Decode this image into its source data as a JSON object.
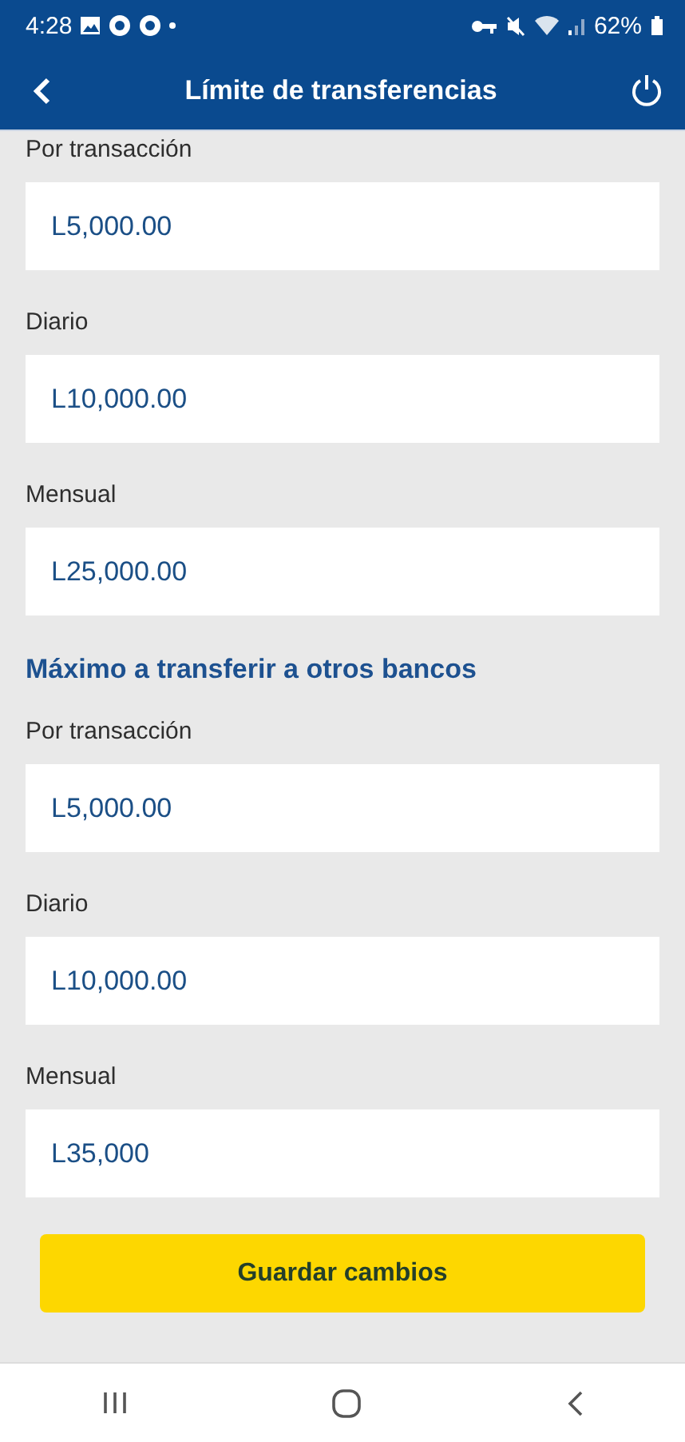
{
  "status_bar": {
    "time": "4:28",
    "battery": "62%"
  },
  "header": {
    "title": "Límite de transferencias"
  },
  "sections": [
    {
      "fields": [
        {
          "label": "Por transacción",
          "value": "L5,000.00"
        },
        {
          "label": "Diario",
          "value": "L10,000.00"
        },
        {
          "label": "Mensual",
          "value": "L25,000.00"
        }
      ]
    },
    {
      "heading": "Máximo a transferir a otros bancos",
      "fields": [
        {
          "label": "Por transacción",
          "value": "L5,000.00"
        },
        {
          "label": "Diario",
          "value": "L10,000.00"
        },
        {
          "label": "Mensual",
          "value": "L35,000"
        }
      ]
    }
  ],
  "save_button": "Guardar cambios"
}
